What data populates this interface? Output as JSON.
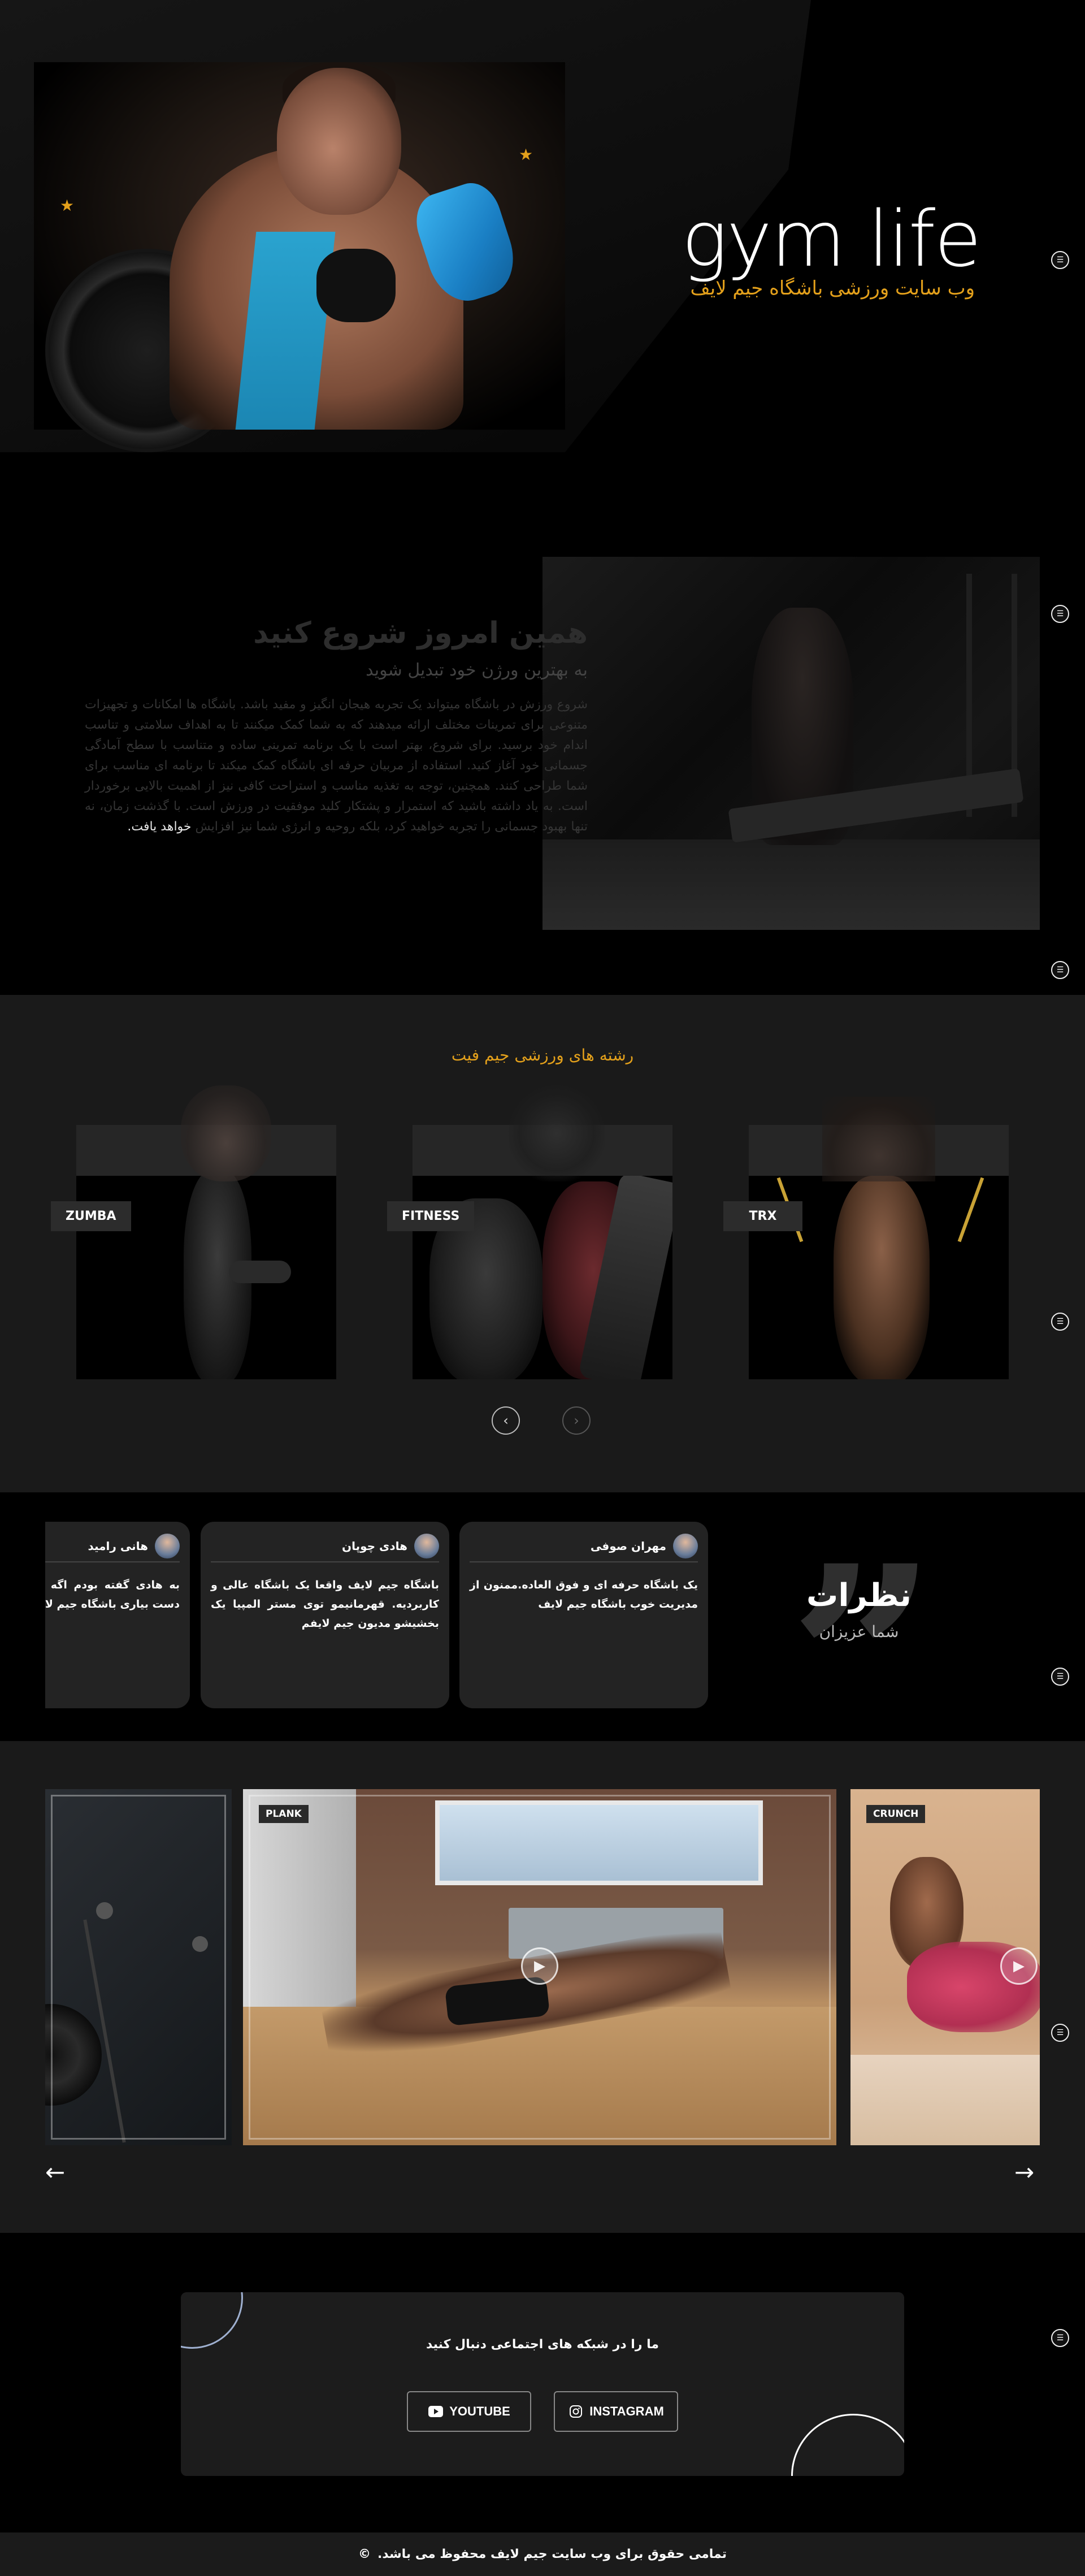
{
  "hero": {
    "title": "gym life",
    "subtitle": "وب سایت ورزشی باشگاه جیم لایف",
    "accent_color": "#e3a01b"
  },
  "about": {
    "title": "همین امروز شروع کنید",
    "subtitle": "به بهترین ورژن خود تبدیل شوید",
    "body": "شروع ورزش در باشگاه میتواند یک تجربه هیجان انگیز و مفید باشد. باشگاه ها امکانات و تجهیزات متنوعی برای تمرینات مختلف ارائه میدهند که به شما کمک میکنند تا به اهداف سلامتی و تناسب اندام خود برسید. برای شروع، بهتر است با یک برنامه تمرینی ساده و متناسب با سطح آمادگی جسمانی خود آغاز کنید. استفاده از مربیان حرفه ای باشگاه کمک میکند تا برنامه ای مناسب برای شما طراحی کنند. همچنین، توجه به تغذیه مناسب و استراحت کافی نیز از اهمیت بالایی برخوردار است. به یاد داشته باشید که استمرار و پشتکار کلید موفقیت در ورزش است. با گذشت زمان، نه تنها بهبود جسمانی را تجربه خواهید کرد، بلکه روحیه و انرژی شما نیز افزایش",
    "body_tail": "خواهد یافت."
  },
  "sports": {
    "title": "رشته های ورزشی جیم فیت",
    "cards": [
      {
        "label": "ZUMBA"
      },
      {
        "label": "FITNESS"
      },
      {
        "label": "TRX"
      }
    ],
    "prev_icon": "chevron-left-icon",
    "next_icon": "chevron-right-icon"
  },
  "testimonials": {
    "title": "نظرات",
    "subtitle": "شما عزیزان",
    "items": [
      {
        "name": "مهران صوفی",
        "text": "یک باشگاه حرفه ای و فوق العاده.ممنون از مدیریت خوب باشگاه جیم لایف"
      },
      {
        "name": "هادی چوپان",
        "text": "باشگاه جیم لایف واقعا یک باشگاه عالی و کاربردیه. قهرمانیمو توی مستر المپیا یک بخشیشو مدیون جیم لایفم"
      },
      {
        "name": "هانی رامید",
        "text": "به هادی گفته بودم اگه مسترالمپیا رو به دست بیاری باشگاه جیم لایف ثبت نام کنی"
      }
    ]
  },
  "videos": {
    "slides": [
      {
        "tag": ""
      },
      {
        "tag": "PLANK"
      },
      {
        "tag": "CRUNCH"
      }
    ],
    "prev_arrow": "←",
    "next_arrow": "→"
  },
  "social": {
    "title": "ما را در شبکه های اجتماعی دنبال کنید",
    "youtube_label": "YOUTUBE",
    "instagram_label": "INSTAGRAM"
  },
  "footer": {
    "text": "تمامی حقوق برای وب سایت جیم لایف محفوظ می باشد.",
    "copyright_symbol": "©"
  }
}
